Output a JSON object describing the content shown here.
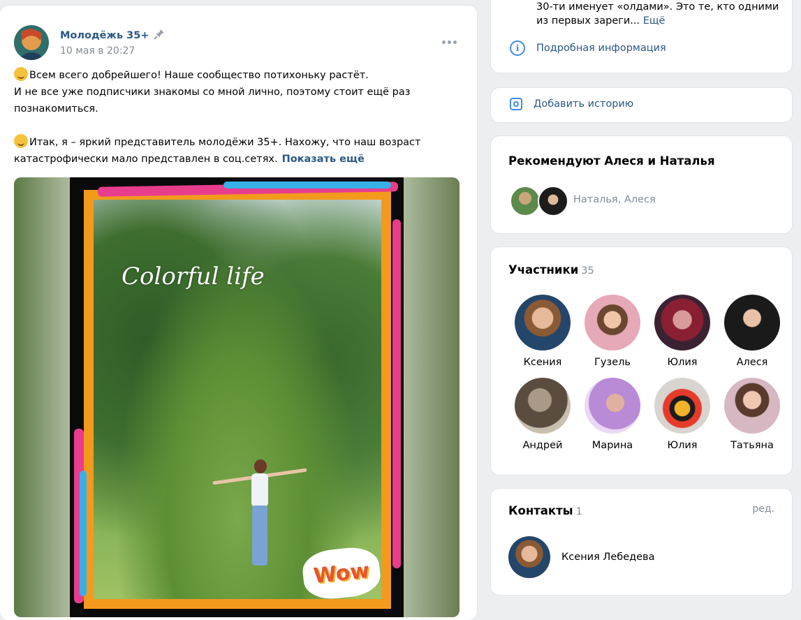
{
  "post": {
    "author": "Молодёжь 35+",
    "date": "10 мая в 20:27",
    "paragraph1_line1": "Всем всего добрейшего! Наше сообщество потихоньку растёт.",
    "paragraph1_line2": "И не все уже подписчики знакомы со мной лично, поэтому стоит ещё раз познакомиться.",
    "paragraph2": "Итак, я – яркий представитель молодёжи 35+. Нахожу, что наш возраст катастрофически мало представлен в соц.сетях.",
    "show_more": "Показать ещё",
    "photo_caption": "Colorful life",
    "photo_sticker": "Wow"
  },
  "info": {
    "description": "30-ти именует «олдами». Это те, кто одними из первых зареги...",
    "more_link": "Ещё",
    "details": "Подробная информация"
  },
  "story": {
    "label": "Добавить историю"
  },
  "recommend": {
    "title": "Рекомендуют Алеся и Наталья",
    "names": "Наталья, Алеся"
  },
  "members": {
    "title": "Участники",
    "count": "35",
    "list": [
      {
        "name": "Ксения"
      },
      {
        "name": "Гузель"
      },
      {
        "name": "Юлия"
      },
      {
        "name": "Алеся"
      },
      {
        "name": "Андрей"
      },
      {
        "name": "Марина"
      },
      {
        "name": "Юлия"
      },
      {
        "name": "Татьяна"
      }
    ]
  },
  "contacts": {
    "title": "Контакты",
    "count": "1",
    "edit": "ред.",
    "name": "Ксения Лебедева"
  },
  "colors": {
    "link": "#2a5885",
    "accent": "#3f8ae0",
    "muted": "#818c99",
    "background": "#edeef0"
  },
  "icons": {
    "pin": "pin-icon",
    "more": "more-dots-icon",
    "info": "info-icon",
    "camera": "story-camera-icon"
  }
}
